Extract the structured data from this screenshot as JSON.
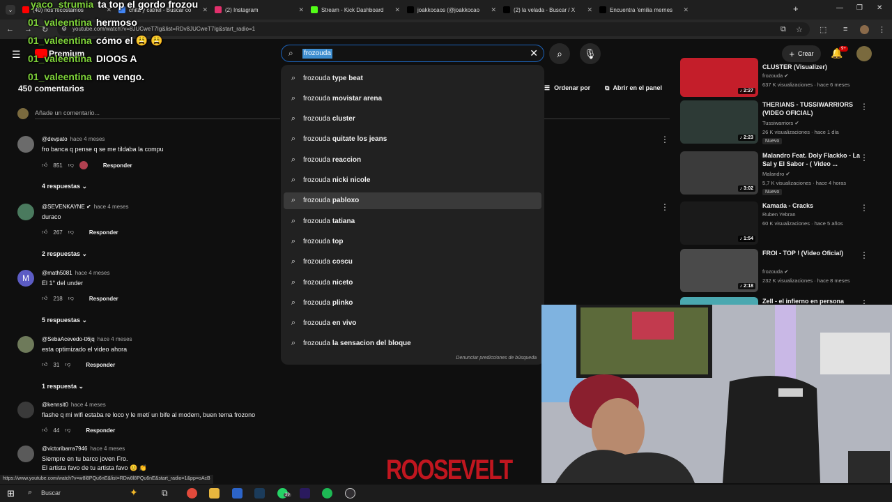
{
  "browser": {
    "tabs": [
      {
        "label": "(40) nos recostamos",
        "favicon_color": "#ff0000"
      },
      {
        "label": "chita y catriel - Buscar co",
        "favicon_color": "#4285f4"
      },
      {
        "label": "(2) Instagram",
        "favicon_color": "#e1306c"
      },
      {
        "label": "Stream - Kick Dashboard",
        "favicon_color": "#53fc18"
      },
      {
        "label": "joakkocaos (@joakkocao",
        "favicon_color": "#000000"
      },
      {
        "label": "(2) la velada - Buscar / X",
        "favicon_color": "#000000"
      },
      {
        "label": "Encuentra 'emilia mernes",
        "favicon_color": "#000000"
      }
    ],
    "url": "youtube.com/watch?v=8JUCweT7Ig&list=RDv8JUCweT7Ig&start_radio=1",
    "status_url": "https://www.youtube.com/watch?v=w8l8PQu6nE&list=RDw8l8PQu6nE&start_radio=1&pp=oAcB"
  },
  "header": {
    "logo_label": "Premium",
    "search_value": "frozouda",
    "create_label": "Crear",
    "notif_badge": "9+"
  },
  "chat": [
    {
      "user": "yaco_strumia",
      "message": "ta top el gordo frozou"
    },
    {
      "user": "01_valeentina",
      "message": "hermoso"
    },
    {
      "user": "01_valeentina",
      "message": "cómo el 😩 😩"
    },
    {
      "user": "01_valeentina",
      "message": "DIOOS A"
    },
    {
      "user": "01_valeentina",
      "message": "me vengo."
    }
  ],
  "comments_section": {
    "count_label": "450 comentarios",
    "add_placeholder": "Añade un comentario...",
    "sort_label": "Ordenar por",
    "panel_label": "Abrir en el panel",
    "reply_label": "Responder",
    "comments": [
      {
        "user": "@devpato",
        "time": "hace 4 meses",
        "text": "fro banca q pense q se me tildaba la compu",
        "likes": "851",
        "replies": "4 respuestas",
        "avatar_color": "#6b6b6b"
      },
      {
        "user": "@SEVENKAYNE ✔",
        "time": "hace 4 meses",
        "text": "duraco",
        "likes": "267",
        "replies": "2 respuestas",
        "avatar_color": "#4a7a5e"
      },
      {
        "user": "@math5081",
        "time": "hace 4 meses",
        "text": "El 1° del under",
        "likes": "218",
        "replies": "5 respuestas",
        "avatar_color": "#5c5cc4",
        "avatar_letter": "M"
      },
      {
        "user": "@SebaAcevedo-tt6jq",
        "time": "hace 4 meses",
        "text": "esta optimizado el video ahora",
        "likes": "31",
        "replies": "1 respuesta",
        "avatar_color": "#6e7a5a"
      },
      {
        "user": "@kennsit0",
        "time": "hace 4 meses",
        "text": "flashe q mi wifi estaba re loco y le metí un bife al modem, buen tema frozono",
        "likes": "44",
        "replies": "",
        "avatar_color": "#3a3a3a"
      },
      {
        "user": "@victoribarra7946",
        "time": "hace 4 meses",
        "text": "Siempre en tu barco joven Fro.",
        "text2": "El artista favo de tu artista favo 😊 👏",
        "likes": "",
        "replies": "",
        "avatar_color": "#5a5a5a"
      }
    ]
  },
  "suggestions": {
    "prefix": "frozouda",
    "items": [
      "type beat",
      "movistar arena",
      "cluster",
      "quitate los jeans",
      "reaccion",
      "nicki nicole",
      "pabloxo",
      "tatiana",
      "top",
      "coscu",
      "niceto",
      "plinko",
      "en vivo",
      "la sensacion del bloque"
    ],
    "highlighted_index": 6,
    "report_label": "Denunciar predicciones de búsqueda"
  },
  "sidebar_videos": [
    {
      "title": "CLUSTER (Visualizer)",
      "channel": "frozouda",
      "verified": true,
      "meta": "637 K visualizaciones · hace 6 meses",
      "duration": "2:27",
      "badge": "",
      "thumb_color": "#c41e2a"
    },
    {
      "title": "THERIANS - TUSSIWARRIORS (VIDEO OFICIAL)",
      "channel": "Tussiwarriors",
      "verified": true,
      "meta": "26 K visualizaciones · hace 1 día",
      "duration": "2:23",
      "badge": "Nuevo",
      "thumb_color": "#2d3a36"
    },
    {
      "title": "Malandro Feat. Doly Flackko - La Sal y El Sabor - ( Video ...",
      "channel": "Malandro",
      "verified": true,
      "meta": "5,7 K visualizaciones · hace 4 horas",
      "duration": "3:02",
      "badge": "Nuevo",
      "thumb_color": "#3b3b3b"
    },
    {
      "title": "Kamada - Cracks",
      "channel": "Ruben Yebran",
      "verified": false,
      "meta": "60 K visualizaciones · hace 5 años",
      "duration": "1:54",
      "badge": "",
      "thumb_color": "#1a1a1a"
    },
    {
      "title": "FROI - TOP ! (Video Oficial)",
      "channel": "frozouda",
      "verified": true,
      "meta": "232 K visualizaciones · hace 8 meses",
      "duration": "2:18",
      "badge": "",
      "thumb_color": "#4a4a4a"
    },
    {
      "title": "Zell - el infierno en persona",
      "channel": "",
      "verified": false,
      "meta": "",
      "duration": "",
      "badge": "",
      "thumb_color": "#4aa8b0"
    }
  ],
  "overlay": {
    "roosevelt_text": "ROOSEVELT"
  },
  "taskbar": {
    "search_label": "Buscar",
    "whatsapp_badge": "39"
  }
}
